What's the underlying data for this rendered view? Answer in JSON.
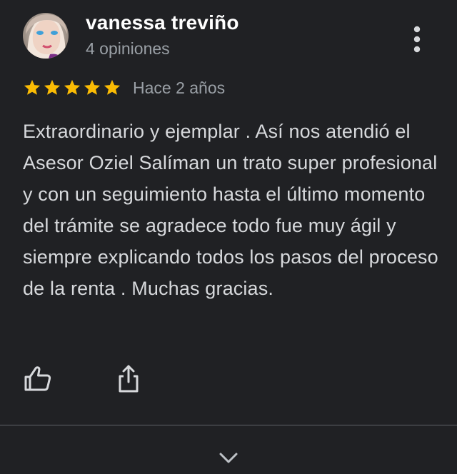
{
  "author": {
    "name": "vanessa treviño",
    "review_count": "4 opiniones",
    "avatar": "user-avatar-photo"
  },
  "rating": {
    "stars": 5,
    "max_stars": 5,
    "icon": "star-icon",
    "color": "#fbbc04"
  },
  "review": {
    "date": "Hace 2 años",
    "text": "Extraordinario y ejemplar . Así nos atendió el Asesor Oziel Salíman un trato super profesional y con un seguimiento hasta el último momento del trámite se agradece todo fue muy ágil y siempre explicando todos los pasos del proceso de la renta . Muchas gracias."
  },
  "actions": {
    "like_icon": "thumbs-up-icon",
    "share_icon": "share-icon",
    "more_icon": "more-vert-icon",
    "expand_icon": "chevron-down-icon"
  },
  "colors": {
    "background": "#202124",
    "primary_text": "#ffffff",
    "secondary_text": "#9aa0a6",
    "divider": "#5f6368"
  }
}
